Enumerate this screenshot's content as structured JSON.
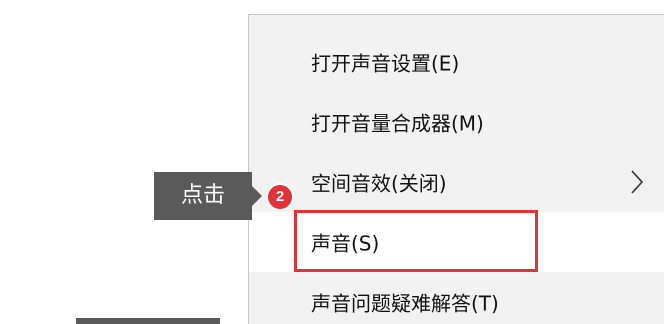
{
  "context_menu": {
    "items": [
      {
        "label": "打开声音设置(E)"
      },
      {
        "label": "打开音量合成器(M)"
      },
      {
        "label": "空间音效(关闭)",
        "submenu_icon": "chevron-right-icon"
      },
      {
        "label": "声音(S)",
        "highlighted": true
      },
      {
        "label": "声音问题疑难解答(T)"
      }
    ]
  },
  "annotation": {
    "callout_text": "点击",
    "step_number": "2",
    "accent_color": "#e0343a"
  }
}
